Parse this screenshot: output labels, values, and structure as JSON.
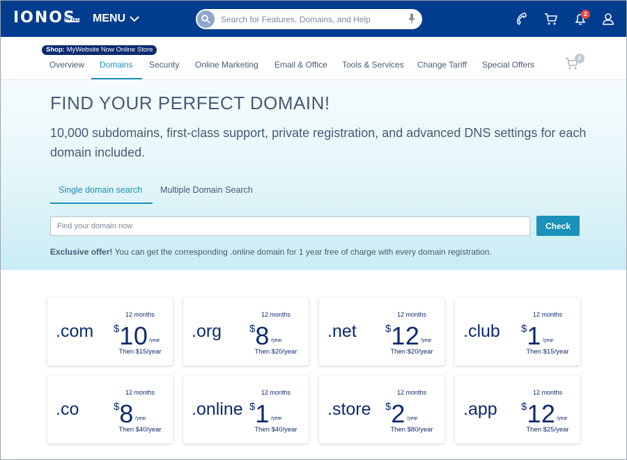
{
  "header": {
    "logo": "IONOS",
    "logo_by": "by",
    "logo_brand": "1&1",
    "menu_label": "MENU",
    "search_placeholder": "Search for Features, Domains, and Help",
    "notification_count": "2"
  },
  "subnav": {
    "shop_prefix": "Shop:",
    "shop_name": "MyWebsite Now Online Store",
    "items": [
      "Overview",
      "Domains",
      "Security",
      "Online Marketing",
      "Email & Office",
      "Tools & Services",
      "Change Tariff",
      "Special Offers"
    ],
    "active": "Domains",
    "cart_count": "0"
  },
  "hero": {
    "title": "FIND YOUR PERFECT DOMAIN!",
    "subtitle": "10,000 subdomains, first-class support, private registration, and advanced DNS settings for each domain included.",
    "tabs": [
      "Single domain search",
      "Multiple Domain Search"
    ],
    "input_placeholder": "Find your domain now",
    "check_label": "Check",
    "offer_bold": "Exclusive offer!",
    "offer_text": " You can get the corresponding .online domain for 1 year free of charge with every domain registration."
  },
  "cards": [
    {
      "tld": ".com",
      "months": "12 months",
      "currency": "$",
      "price": "10",
      "per": "/year",
      "then": "Then $15/year"
    },
    {
      "tld": ".org",
      "months": "12 months",
      "currency": "$",
      "price": "8",
      "per": "/year",
      "then": "Then $20/year"
    },
    {
      "tld": ".net",
      "months": "12 months",
      "currency": "$",
      "price": "12",
      "per": "/year",
      "then": "Then $20/year"
    },
    {
      "tld": ".club",
      "months": "12 months",
      "currency": "$",
      "price": "1",
      "per": "/year",
      "then": "Then $15/year"
    },
    {
      "tld": ".co",
      "months": "12 months",
      "currency": "$",
      "price": "8",
      "per": "/year",
      "then": "Then $40/year"
    },
    {
      "tld": ".online",
      "months": "12 months",
      "currency": "$",
      "price": "1",
      "per": "/year",
      "then": "Then $40/year"
    },
    {
      "tld": ".store",
      "months": "12 months",
      "currency": "$",
      "price": "2",
      "per": "/year",
      "then": "Then $80/year"
    },
    {
      "tld": ".app",
      "months": "12 months",
      "currency": "$",
      "price": "12",
      "per": "/year",
      "then": "Then $25/year"
    }
  ],
  "colors": {
    "brand": "#003d8f",
    "accent": "#1a91b8",
    "text": "#465a75",
    "price": "#0b2a6f",
    "badge": "#e8483f"
  }
}
